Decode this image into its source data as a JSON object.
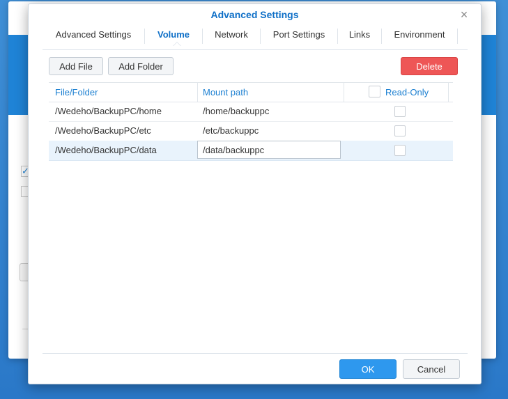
{
  "dialog": {
    "title": "Advanced Settings",
    "close_symbol": "×"
  },
  "tabs": [
    {
      "label": "Advanced Settings",
      "active": false
    },
    {
      "label": "Volume",
      "active": true
    },
    {
      "label": "Network",
      "active": false
    },
    {
      "label": "Port Settings",
      "active": false
    },
    {
      "label": "Links",
      "active": false
    },
    {
      "label": "Environment",
      "active": false
    }
  ],
  "toolbar": {
    "add_file": "Add File",
    "add_folder": "Add Folder",
    "delete": "Delete"
  },
  "table": {
    "headers": {
      "file_folder": "File/Folder",
      "mount_path": "Mount path",
      "read_only": "Read-Only"
    },
    "rows": [
      {
        "path": "/Wedeho/BackupPC/home",
        "mount": "/home/backuppc",
        "read_only": false,
        "selected": false
      },
      {
        "path": "/Wedeho/BackupPC/etc",
        "mount": "/etc/backuppc",
        "read_only": false,
        "selected": false
      },
      {
        "path": "/Wedeho/BackupPC/data",
        "mount": "/data/backuppc",
        "read_only": false,
        "selected": true
      }
    ]
  },
  "footer": {
    "ok": "OK",
    "cancel": "Cancel"
  },
  "colors": {
    "accent": "#0e6fc7",
    "header_text": "#1b7fd1",
    "delete": "#ee5656",
    "ok": "#2e98ee",
    "selected_row": "#e9f3fc",
    "desktop": "#2a78c8"
  }
}
